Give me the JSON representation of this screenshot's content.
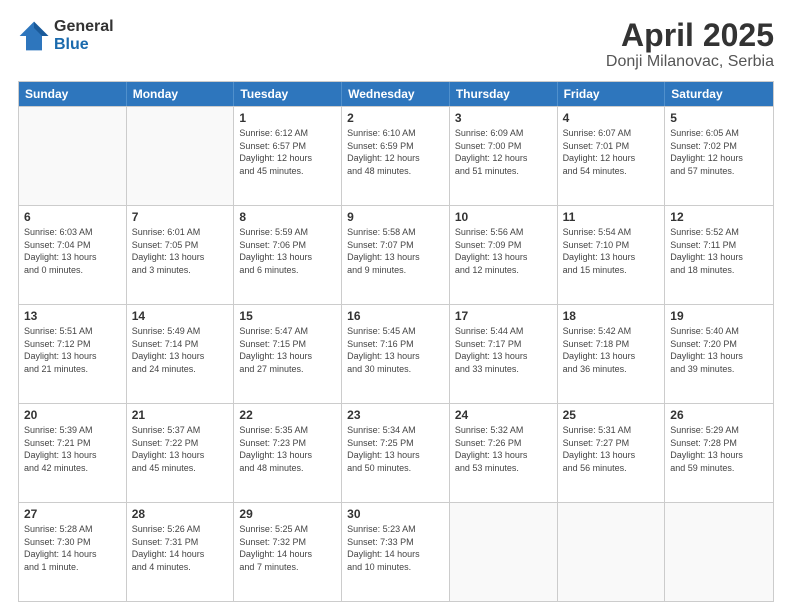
{
  "logo": {
    "general": "General",
    "blue": "Blue"
  },
  "title": "April 2025",
  "subtitle": "Donji Milanovac, Serbia",
  "headers": [
    "Sunday",
    "Monday",
    "Tuesday",
    "Wednesday",
    "Thursday",
    "Friday",
    "Saturday"
  ],
  "rows": [
    [
      {
        "day": "",
        "detail": ""
      },
      {
        "day": "",
        "detail": ""
      },
      {
        "day": "1",
        "detail": "Sunrise: 6:12 AM\nSunset: 6:57 PM\nDaylight: 12 hours\nand 45 minutes."
      },
      {
        "day": "2",
        "detail": "Sunrise: 6:10 AM\nSunset: 6:59 PM\nDaylight: 12 hours\nand 48 minutes."
      },
      {
        "day": "3",
        "detail": "Sunrise: 6:09 AM\nSunset: 7:00 PM\nDaylight: 12 hours\nand 51 minutes."
      },
      {
        "day": "4",
        "detail": "Sunrise: 6:07 AM\nSunset: 7:01 PM\nDaylight: 12 hours\nand 54 minutes."
      },
      {
        "day": "5",
        "detail": "Sunrise: 6:05 AM\nSunset: 7:02 PM\nDaylight: 12 hours\nand 57 minutes."
      }
    ],
    [
      {
        "day": "6",
        "detail": "Sunrise: 6:03 AM\nSunset: 7:04 PM\nDaylight: 13 hours\nand 0 minutes."
      },
      {
        "day": "7",
        "detail": "Sunrise: 6:01 AM\nSunset: 7:05 PM\nDaylight: 13 hours\nand 3 minutes."
      },
      {
        "day": "8",
        "detail": "Sunrise: 5:59 AM\nSunset: 7:06 PM\nDaylight: 13 hours\nand 6 minutes."
      },
      {
        "day": "9",
        "detail": "Sunrise: 5:58 AM\nSunset: 7:07 PM\nDaylight: 13 hours\nand 9 minutes."
      },
      {
        "day": "10",
        "detail": "Sunrise: 5:56 AM\nSunset: 7:09 PM\nDaylight: 13 hours\nand 12 minutes."
      },
      {
        "day": "11",
        "detail": "Sunrise: 5:54 AM\nSunset: 7:10 PM\nDaylight: 13 hours\nand 15 minutes."
      },
      {
        "day": "12",
        "detail": "Sunrise: 5:52 AM\nSunset: 7:11 PM\nDaylight: 13 hours\nand 18 minutes."
      }
    ],
    [
      {
        "day": "13",
        "detail": "Sunrise: 5:51 AM\nSunset: 7:12 PM\nDaylight: 13 hours\nand 21 minutes."
      },
      {
        "day": "14",
        "detail": "Sunrise: 5:49 AM\nSunset: 7:14 PM\nDaylight: 13 hours\nand 24 minutes."
      },
      {
        "day": "15",
        "detail": "Sunrise: 5:47 AM\nSunset: 7:15 PM\nDaylight: 13 hours\nand 27 minutes."
      },
      {
        "day": "16",
        "detail": "Sunrise: 5:45 AM\nSunset: 7:16 PM\nDaylight: 13 hours\nand 30 minutes."
      },
      {
        "day": "17",
        "detail": "Sunrise: 5:44 AM\nSunset: 7:17 PM\nDaylight: 13 hours\nand 33 minutes."
      },
      {
        "day": "18",
        "detail": "Sunrise: 5:42 AM\nSunset: 7:18 PM\nDaylight: 13 hours\nand 36 minutes."
      },
      {
        "day": "19",
        "detail": "Sunrise: 5:40 AM\nSunset: 7:20 PM\nDaylight: 13 hours\nand 39 minutes."
      }
    ],
    [
      {
        "day": "20",
        "detail": "Sunrise: 5:39 AM\nSunset: 7:21 PM\nDaylight: 13 hours\nand 42 minutes."
      },
      {
        "day": "21",
        "detail": "Sunrise: 5:37 AM\nSunset: 7:22 PM\nDaylight: 13 hours\nand 45 minutes."
      },
      {
        "day": "22",
        "detail": "Sunrise: 5:35 AM\nSunset: 7:23 PM\nDaylight: 13 hours\nand 48 minutes."
      },
      {
        "day": "23",
        "detail": "Sunrise: 5:34 AM\nSunset: 7:25 PM\nDaylight: 13 hours\nand 50 minutes."
      },
      {
        "day": "24",
        "detail": "Sunrise: 5:32 AM\nSunset: 7:26 PM\nDaylight: 13 hours\nand 53 minutes."
      },
      {
        "day": "25",
        "detail": "Sunrise: 5:31 AM\nSunset: 7:27 PM\nDaylight: 13 hours\nand 56 minutes."
      },
      {
        "day": "26",
        "detail": "Sunrise: 5:29 AM\nSunset: 7:28 PM\nDaylight: 13 hours\nand 59 minutes."
      }
    ],
    [
      {
        "day": "27",
        "detail": "Sunrise: 5:28 AM\nSunset: 7:30 PM\nDaylight: 14 hours\nand 1 minute."
      },
      {
        "day": "28",
        "detail": "Sunrise: 5:26 AM\nSunset: 7:31 PM\nDaylight: 14 hours\nand 4 minutes."
      },
      {
        "day": "29",
        "detail": "Sunrise: 5:25 AM\nSunset: 7:32 PM\nDaylight: 14 hours\nand 7 minutes."
      },
      {
        "day": "30",
        "detail": "Sunrise: 5:23 AM\nSunset: 7:33 PM\nDaylight: 14 hours\nand 10 minutes."
      },
      {
        "day": "",
        "detail": ""
      },
      {
        "day": "",
        "detail": ""
      },
      {
        "day": "",
        "detail": ""
      }
    ]
  ]
}
